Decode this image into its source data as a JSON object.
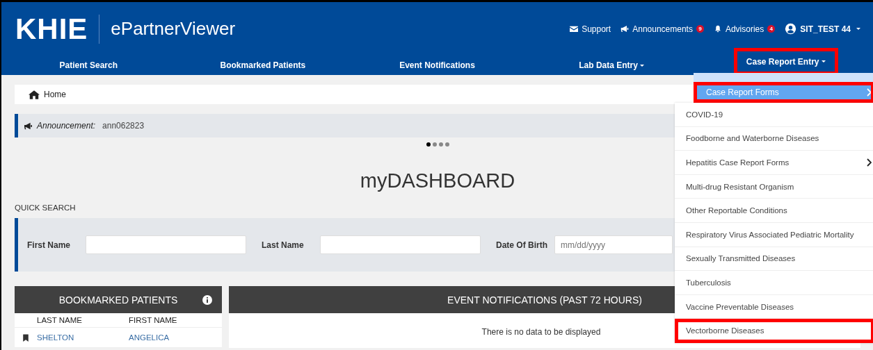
{
  "header": {
    "logo": "KHIE",
    "app_name": "ePartnerViewer",
    "links": [
      {
        "label": "Support"
      },
      {
        "label": "Announcements",
        "badge": "9"
      },
      {
        "label": "Advisories",
        "badge": "4"
      }
    ],
    "user": {
      "name": "SIT_TEST 44"
    }
  },
  "nav": [
    {
      "label": "Patient Search",
      "dropdown": false,
      "highlighted": false
    },
    {
      "label": "Bookmarked Patients",
      "dropdown": false,
      "highlighted": false
    },
    {
      "label": "Event Notifications",
      "dropdown": false,
      "highlighted": false
    },
    {
      "label": "Lab Data Entry",
      "dropdown": true,
      "highlighted": false
    },
    {
      "label": "Case Report Entry",
      "dropdown": true,
      "highlighted": true
    }
  ],
  "breadcrumb": {
    "label": "Home"
  },
  "announcement": {
    "label": "Announcement:",
    "text": "ann062823"
  },
  "carousel": [
    {
      "selected": true
    },
    {
      "selected": false
    },
    {
      "selected": false
    },
    {
      "selected": false
    }
  ],
  "title": "myDASHBOARD",
  "quick_search": {
    "title": "QUICK SEARCH",
    "fields": [
      {
        "label": "First Name"
      },
      {
        "label": "Last Name"
      },
      {
        "label": "Date Of Birth",
        "placeholder": "mm/dd/yyyy"
      }
    ]
  },
  "bookmarked_patients": {
    "title": "BOOKMARKED PATIENTS",
    "columns": [
      "LAST NAME",
      "FIRST NAME"
    ],
    "rows": [
      {
        "bookmarked": true,
        "cells": [
          "SHELTON",
          "ANGELICA"
        ]
      }
    ]
  },
  "event_notifications": {
    "title": "EVENT NOTIFICATIONS (PAST 72 HOURS)",
    "empty_text": "There is no data to be displayed"
  },
  "dropdown": {
    "items": [
      {
        "label": "Case Report Forms",
        "selected": true,
        "highlighted": true,
        "submenu": true
      }
    ]
  },
  "submenu": {
    "items": [
      {
        "label": "COVID-19",
        "submenu": false,
        "highlighted": false
      },
      {
        "label": "Foodborne and Waterborne Diseases",
        "submenu": false,
        "highlighted": false
      },
      {
        "label": "Hepatitis Case Report Forms",
        "submenu": true,
        "highlighted": false
      },
      {
        "label": "Multi-drug Resistant Organism",
        "submenu": false,
        "highlighted": false
      },
      {
        "label": "Other Reportable Conditions",
        "submenu": false,
        "highlighted": false
      },
      {
        "label": "Respiratory Virus Associated Pediatric Mortality",
        "submenu": false,
        "highlighted": false
      },
      {
        "label": "Sexually Transmitted Diseases",
        "submenu": false,
        "highlighted": false
      },
      {
        "label": "Tuberculosis",
        "submenu": false,
        "highlighted": false
      },
      {
        "label": "Vaccine Preventable Diseases",
        "submenu": false,
        "highlighted": false
      },
      {
        "label": "Vectorborne Diseases",
        "submenu": false,
        "highlighted": true
      }
    ]
  }
}
